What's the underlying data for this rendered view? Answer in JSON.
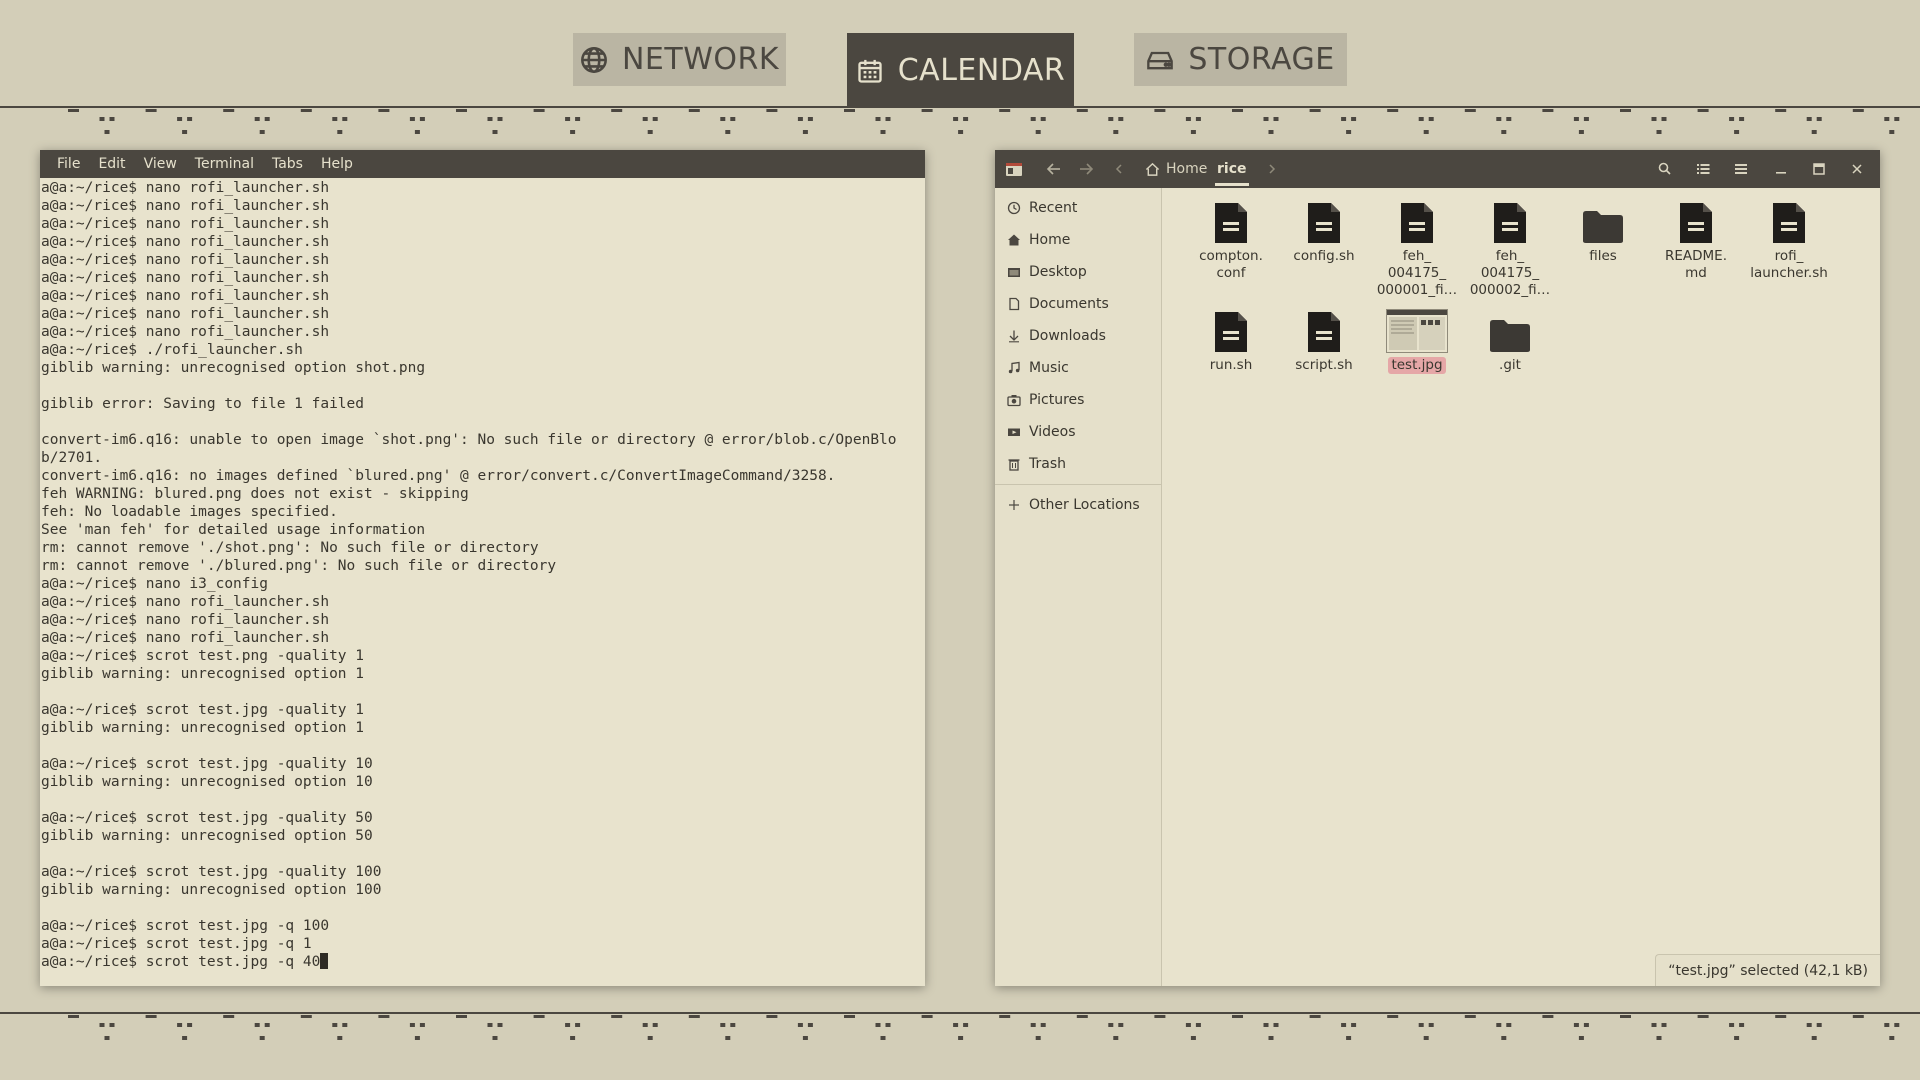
{
  "topbar": {
    "tabs": [
      {
        "label": "NETWORK",
        "icon": "globe-icon",
        "active": false
      },
      {
        "label": "CALENDAR",
        "icon": "calendar-icon",
        "active": true
      },
      {
        "label": "STORAGE",
        "icon": "drive-icon",
        "active": false
      }
    ]
  },
  "terminal": {
    "menu": [
      "File",
      "Edit",
      "View",
      "Terminal",
      "Tabs",
      "Help"
    ],
    "lines": [
      "a@a:~/rice$ nano rofi_launcher.sh",
      "a@a:~/rice$ nano rofi_launcher.sh",
      "a@a:~/rice$ nano rofi_launcher.sh",
      "a@a:~/rice$ nano rofi_launcher.sh",
      "a@a:~/rice$ nano rofi_launcher.sh",
      "a@a:~/rice$ nano rofi_launcher.sh",
      "a@a:~/rice$ nano rofi_launcher.sh",
      "a@a:~/rice$ nano rofi_launcher.sh",
      "a@a:~/rice$ nano rofi_launcher.sh",
      "a@a:~/rice$ ./rofi_launcher.sh",
      "giblib warning: unrecognised option shot.png",
      "",
      "giblib error: Saving to file 1 failed",
      "",
      "convert-im6.q16: unable to open image `shot.png': No such file or directory @ error/blob.c/OpenBlob/2701.",
      "convert-im6.q16: no images defined `blured.png' @ error/convert.c/ConvertImageCommand/3258.",
      "feh WARNING: blured.png does not exist - skipping",
      "feh: No loadable images specified.",
      "See 'man feh' for detailed usage information",
      "rm: cannot remove './shot.png': No such file or directory",
      "rm: cannot remove './blured.png': No such file or directory",
      "a@a:~/rice$ nano i3_config",
      "a@a:~/rice$ nano rofi_launcher.sh",
      "a@a:~/rice$ nano rofi_launcher.sh",
      "a@a:~/rice$ nano rofi_launcher.sh",
      "a@a:~/rice$ scrot test.png -quality 1",
      "giblib warning: unrecognised option 1",
      "",
      "a@a:~/rice$ scrot test.jpg -quality 1",
      "giblib warning: unrecognised option 1",
      "",
      "a@a:~/rice$ scrot test.jpg -quality 10",
      "giblib warning: unrecognised option 10",
      "",
      "a@a:~/rice$ scrot test.jpg -quality 50",
      "giblib warning: unrecognised option 50",
      "",
      "a@a:~/rice$ scrot test.jpg -quality 100",
      "giblib warning: unrecognised option 100",
      "",
      "a@a:~/rice$ scrot test.jpg -q 100",
      "a@a:~/rice$ scrot test.jpg -q 1",
      "a@a:~/rice$ scrot test.jpg -q 40"
    ]
  },
  "filemanager": {
    "breadcrumb": {
      "home": "Home",
      "current": "rice"
    },
    "sidebar": [
      {
        "label": "Recent",
        "icon": "clock-icon"
      },
      {
        "label": "Home",
        "icon": "home-icon"
      },
      {
        "label": "Desktop",
        "icon": "desktop-folder-icon"
      },
      {
        "label": "Documents",
        "icon": "document-icon"
      },
      {
        "label": "Downloads",
        "icon": "download-icon"
      },
      {
        "label": "Music",
        "icon": "music-icon"
      },
      {
        "label": "Pictures",
        "icon": "camera-icon"
      },
      {
        "label": "Videos",
        "icon": "video-icon"
      },
      {
        "label": "Trash",
        "icon": "trash-icon"
      },
      {
        "label": "Other Locations",
        "icon": "plus-icon"
      }
    ],
    "files": [
      {
        "name": "compton.\nconf",
        "type": "doc"
      },
      {
        "name": "config.sh",
        "type": "doc"
      },
      {
        "name": "feh_\n004175_\n000001_fi…",
        "type": "doc"
      },
      {
        "name": "feh_\n004175_\n000002_fi…",
        "type": "doc"
      },
      {
        "name": "files",
        "type": "folder"
      },
      {
        "name": "README.\nmd",
        "type": "doc"
      },
      {
        "name": "rofi_\nlauncher.sh",
        "type": "doc"
      },
      {
        "name": "run.sh",
        "type": "doc"
      },
      {
        "name": "script.sh",
        "type": "doc"
      },
      {
        "name": "test.jpg",
        "type": "image",
        "selected": true
      },
      {
        "name": ".git",
        "type": "folder"
      }
    ],
    "status": "“test.jpg” selected  (42,1 kB)"
  },
  "colors": {
    "background": "#d3ceb8",
    "panel_dark": "#4b4740",
    "window_bg": "#e8e3cd",
    "selection": "#e5a7a7"
  }
}
